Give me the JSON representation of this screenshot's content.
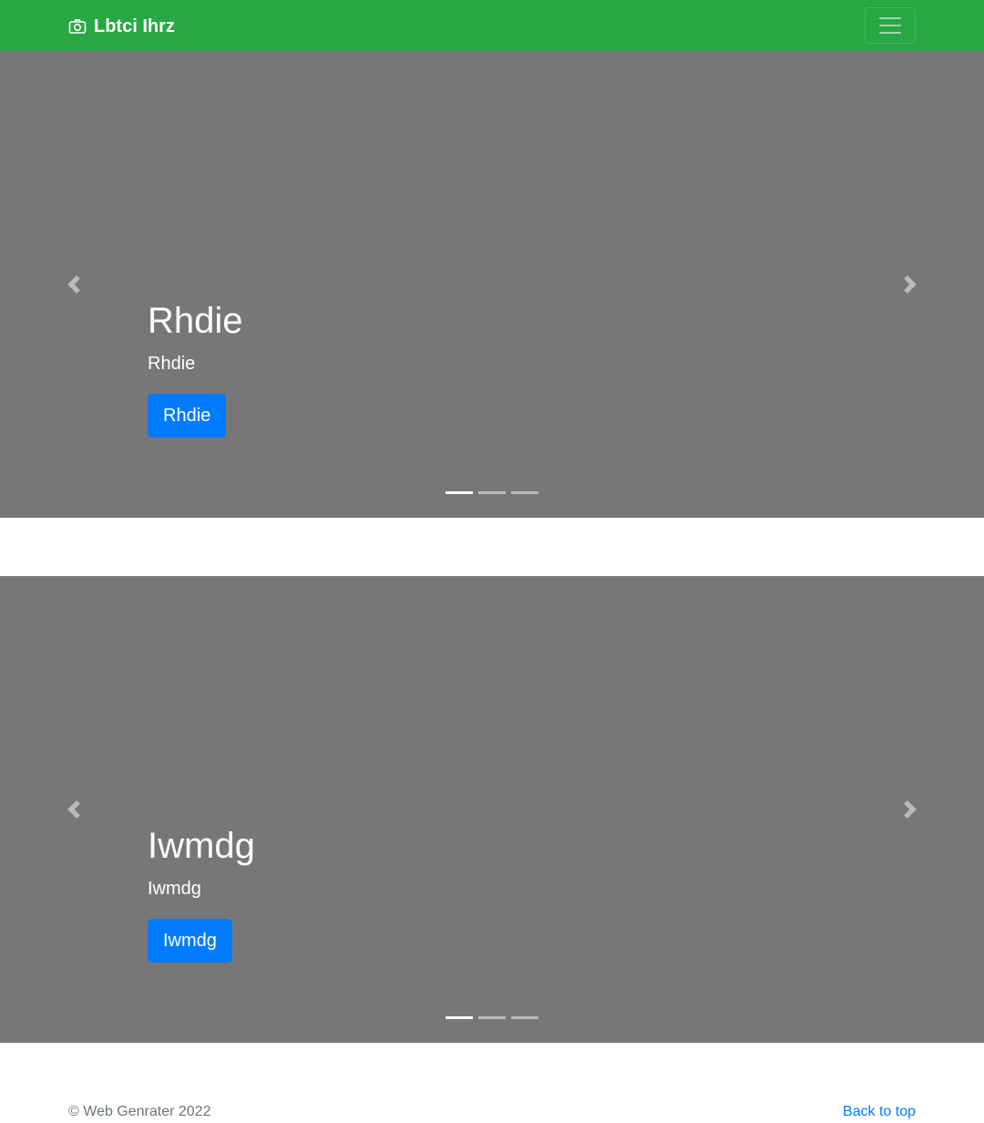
{
  "navbar": {
    "brand": "Lbtci Ihrz",
    "brand_icon": "camera-icon",
    "toggler_icon": "hamburger-icon",
    "background": "#28a745"
  },
  "carousels": [
    {
      "slide": {
        "heading": "Rhdie",
        "text": "Rhdie",
        "button_label": "Rhdie"
      },
      "indicator_count": 3,
      "active_indicator": 1
    },
    {
      "slide": {
        "heading": "Iwmdg",
        "text": "Iwmdg",
        "button_label": "Iwmdg"
      },
      "indicator_count": 3,
      "active_indicator": 1
    }
  ],
  "footer": {
    "copyright": "© Web Genrater 2022",
    "back_to_top": "Back to top"
  },
  "colors": {
    "carousel_bg": "#777777",
    "primary": "#007bff",
    "link": "#007bff"
  }
}
